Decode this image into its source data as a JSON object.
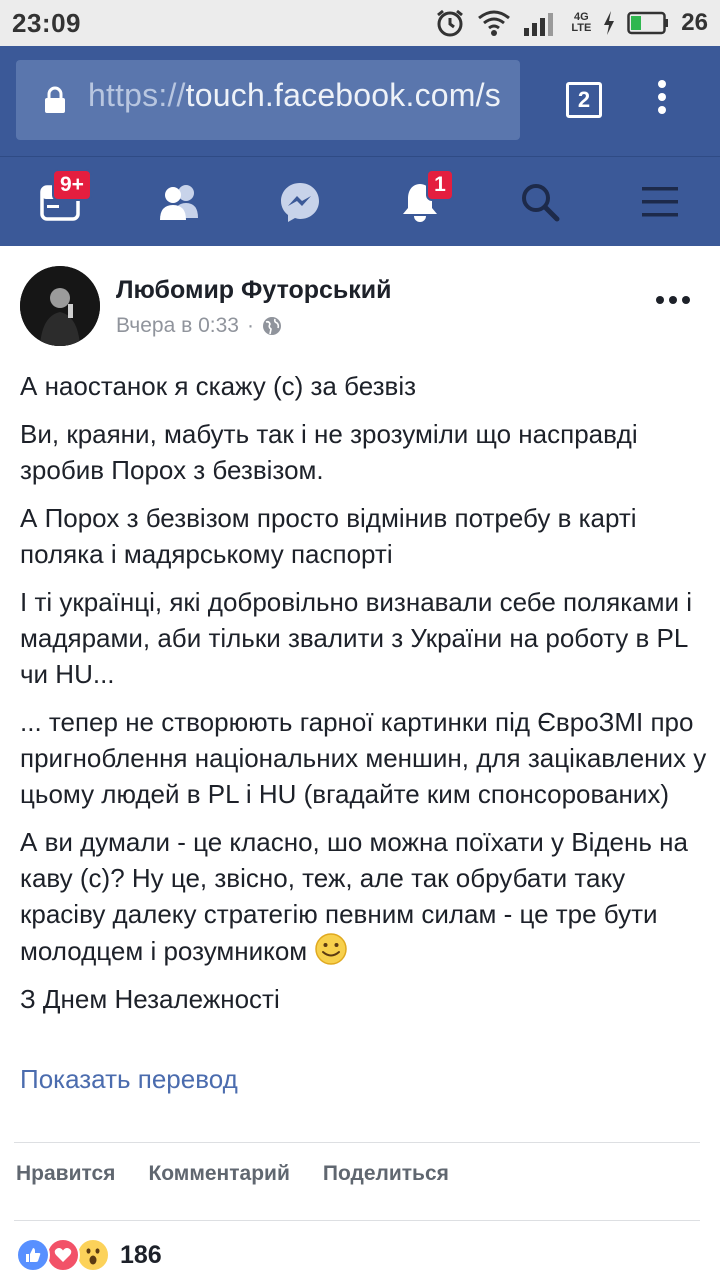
{
  "status_bar": {
    "time": "23:09",
    "network": "4G",
    "network_sub": "LTE",
    "battery": "26",
    "icons": [
      "alarm-icon",
      "wifi-icon",
      "signal-icon",
      "charging-icon",
      "battery-icon"
    ]
  },
  "browser": {
    "url_protocol": "https://",
    "url_host": "touch.facebook.com/s",
    "tab_count": "2",
    "toolbar_color": "#3b5998"
  },
  "nav": {
    "items": [
      {
        "icon": "news-feed-icon",
        "badge": "9+"
      },
      {
        "icon": "friends-icon",
        "badge": ""
      },
      {
        "icon": "messenger-icon",
        "badge": ""
      },
      {
        "icon": "notifications-icon",
        "badge": "1"
      },
      {
        "icon": "search-icon",
        "badge": ""
      },
      {
        "icon": "menu-icon",
        "badge": ""
      }
    ],
    "badge_color": "#e41e3f"
  },
  "post": {
    "author": "Любомир Футорський",
    "time": "Вчера в 0:33",
    "separator": "·",
    "privacy_icon": "globe-icon",
    "paragraphs": [
      "А наостанок я скажу (с) за безвіз",
      "Ви, краяни, мабуть так і не зрозуміли що насправді зробив Порох з безвізом.",
      "А Порох з безвізом просто відмінив потребу в карті поляка і мадярському паспорті",
      "І ті українці, які добровільно визнавали себе поляками і мадярами, аби тільки звалити з України на роботу в PL чи HU...",
      "... тепер не створюють гарної картинки під ЄвроЗМІ про пригноблення національних меншин, для зацікавлених у цьому людей в PL і HU (вгадайте ким спонсорованих)",
      "А ви думали - це класно, шо можна поїхати у Відень на каву (с)? Ну це, звісно, теж, але так обрубати таку красіву далеку стратегію певним силам - це тре бути молодцем і розумником",
      "З Днем Незалежності"
    ],
    "translate_link": "Показать перевод",
    "actions": {
      "like": "Нравится",
      "comment": "Комментарий",
      "share": "Поделиться"
    },
    "reactions": {
      "icons": [
        "like-reaction-icon",
        "love-reaction-icon",
        "wow-reaction-icon"
      ],
      "count": "186"
    },
    "link_color": "#4b6cae"
  }
}
